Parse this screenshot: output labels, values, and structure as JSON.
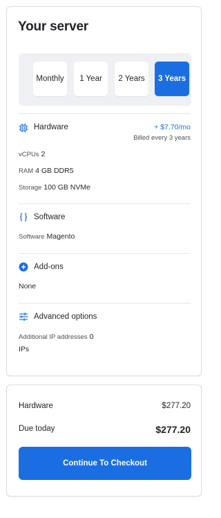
{
  "server": {
    "title": "Your server",
    "periods": [
      "Monthly",
      "1 Year",
      "2 Years",
      "3 Years"
    ],
    "selected_period": "3 Years"
  },
  "hardware": {
    "title": "Hardware",
    "price": "+ $7.70/mo",
    "billed": "Billed every 3 years",
    "specs": [
      {
        "label": "vCPUs",
        "value": "2"
      },
      {
        "label": "RAM",
        "value": "4 GB DDR5"
      },
      {
        "label": "Storage",
        "value": "100 GB NVMe"
      }
    ]
  },
  "software": {
    "title": "Software",
    "label": "Software",
    "value": "Magento"
  },
  "addons": {
    "title": "Add-ons",
    "value": "None"
  },
  "advanced": {
    "title": "Advanced options",
    "ip_label": "Additional IP addresses",
    "ip_count": "0",
    "ip_unit": "IPs"
  },
  "summary": {
    "hardware_label": "Hardware",
    "hardware_value": "$277.20",
    "due_label": "Due today",
    "due_value": "$277.20",
    "checkout_label": "Continue To Checkout"
  },
  "colors": {
    "accent": "#1b6ee2",
    "period_bg": "#eef0f3",
    "border": "#d9dce1"
  },
  "icons": {
    "hardware": "chip-icon",
    "software": "braces-icon",
    "addons": "plus-circle-icon",
    "advanced": "sliders-icon"
  }
}
